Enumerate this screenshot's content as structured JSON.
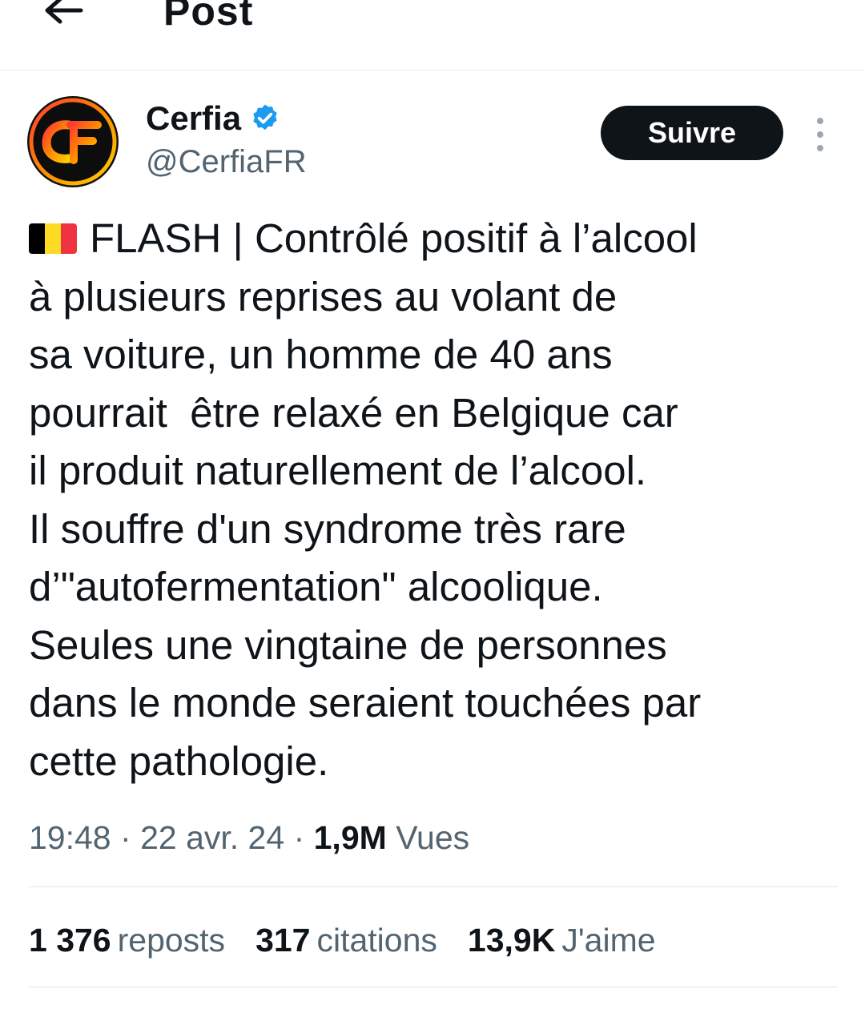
{
  "header": {
    "title": "Post",
    "back_icon": "arrow-left-icon"
  },
  "author": {
    "name": "Cerfia",
    "handle": "@CerfiaFR",
    "verified_icon": "verified-badge-icon",
    "verified_color": "#1d9bf0",
    "avatar_text": "CF"
  },
  "actions": {
    "follow_label": "Suivre",
    "more_icon": "more-vertical-icon"
  },
  "tweet": {
    "flag": "belgium-flag-emoji",
    "lines": [
      "FLASH | Contrôlé positif à l’alcool",
      "à plusieurs reprises au volant de",
      "sa voiture, un homme de 40 ans",
      "pourrait  être relaxé en Belgique car",
      "il produit naturellement de l’alcool.",
      "Il souffre d'un syndrome très rare",
      "d’\"autofermentation\" alcoolique.",
      "Seules une vingtaine de personnes",
      "dans le monde seraient touchées par",
      "cette pathologie."
    ]
  },
  "meta": {
    "time": "19:48",
    "date": "22 avr. 24",
    "views_count": "1,9M",
    "views_label": "Vues",
    "separator": "·"
  },
  "stats": {
    "reposts_count": "1 376",
    "reposts_label": "reposts",
    "quotes_count": "317",
    "quotes_label": "citations",
    "likes_count": "13,9K",
    "likes_label": "J'aime"
  },
  "colors": {
    "text": "#0f1419",
    "secondary": "#536471",
    "button_bg": "#0f1419",
    "flag_black": "#000000",
    "flag_yellow": "#fdda24",
    "flag_red": "#ef3340"
  }
}
